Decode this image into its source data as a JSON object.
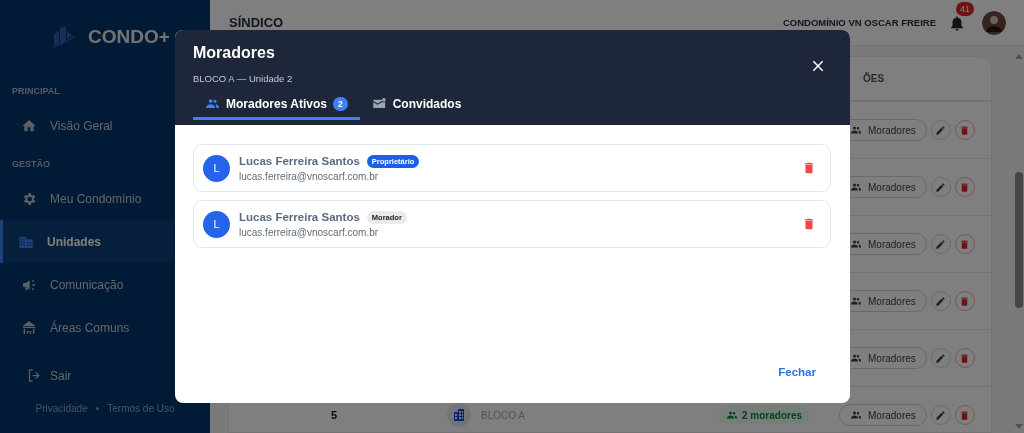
{
  "sidebar": {
    "brand": "CONDO+",
    "sections": [
      {
        "title": "PRINCIPAL",
        "items": [
          {
            "label": "Visão Geral",
            "selected": false
          }
        ]
      },
      {
        "title": "GESTÃO",
        "items": [
          {
            "label": "Meu Condomínio",
            "selected": false
          },
          {
            "label": "Unidades",
            "selected": true
          },
          {
            "label": "Comunicação",
            "selected": false
          },
          {
            "label": "Áreas Comuns",
            "selected": false
          }
        ]
      }
    ],
    "logout": "Sair",
    "footer_links": [
      "Privacidade",
      "Termos de Uso"
    ],
    "footer_separator": "•"
  },
  "header": {
    "title": "SÍNDICO",
    "condo": "CONDOMÍNIO VN OSCAR FREIRE",
    "notifications": "41"
  },
  "table": {
    "actions_heading": "ÕES",
    "rows": [
      {
        "residents_button": "Moradores"
      },
      {
        "residents_button": "Moradores"
      },
      {
        "residents_button": "Moradores"
      },
      {
        "residents_button": "Moradores"
      },
      {
        "residents_button": "Moradores"
      },
      {
        "number": "5",
        "block": "BLOCO A",
        "residents": "2 moradores",
        "residents_button": "Moradores"
      }
    ]
  },
  "modal": {
    "title": "Moradores",
    "subtitle": "BLOCO A — Unidade 2",
    "tabs": [
      {
        "label": "Moradores Ativos",
        "count": "2",
        "selected": true
      },
      {
        "label": "Convidados",
        "selected": false
      }
    ],
    "residents": [
      {
        "initial": "L",
        "name": "Lucas Ferreira Santos",
        "role": {
          "label": "Proprietário",
          "kind": "owner"
        },
        "email": "lucas.ferreira@vnoscarf.com.br"
      },
      {
        "initial": "L",
        "name": "Lucas Ferreira Santos",
        "role": {
          "label": "Morador",
          "kind": "resident"
        },
        "email": "lucas.ferreira@vnoscarf.com.br"
      }
    ],
    "close_button": "Fechar"
  }
}
